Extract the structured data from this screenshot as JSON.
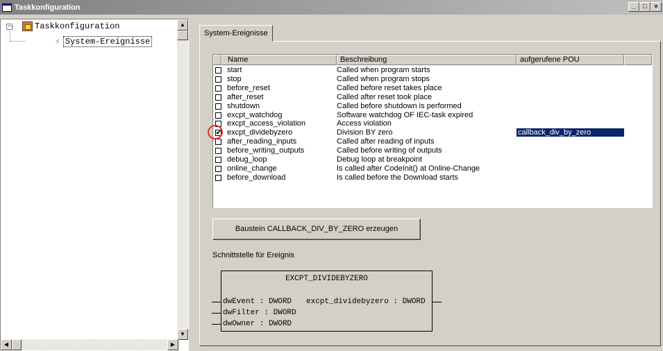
{
  "window": {
    "title": "Taskkonfiguration",
    "buttons": [
      "_",
      "□",
      "×"
    ]
  },
  "tree": {
    "root": {
      "label": "Taskkonfiguration",
      "expander": "−",
      "icon": "task-config-icon"
    },
    "child": {
      "label": "System-Ereignisse",
      "icon": "lightning-icon"
    }
  },
  "tab": {
    "label": "System-Ereignisse"
  },
  "list": {
    "columns": [
      "Name",
      "Beschreibung",
      "aufgerufene POU"
    ],
    "rows": [
      {
        "checked": false,
        "name": "start",
        "desc": "Called when program starts",
        "pou": ""
      },
      {
        "checked": false,
        "name": "stop",
        "desc": "Called when program stops",
        "pou": ""
      },
      {
        "checked": false,
        "name": "before_reset",
        "desc": "Called before reset takes place",
        "pou": ""
      },
      {
        "checked": false,
        "name": "after_reset",
        "desc": "Called after reset took place",
        "pou": ""
      },
      {
        "checked": false,
        "name": "shutdown",
        "desc": "Called before shutdown is performed",
        "pou": ""
      },
      {
        "checked": false,
        "name": "excpt_watchdog",
        "desc": "Software watchdog OF IEC-task expired",
        "pou": ""
      },
      {
        "checked": false,
        "name": "excpt_access_violation",
        "desc": "Access violation",
        "pou": ""
      },
      {
        "checked": true,
        "name": "excpt_dividebyzero",
        "desc": "Division BY zero",
        "pou": "callback_div_by_zero"
      },
      {
        "checked": false,
        "name": "after_reading_inputs",
        "desc": "Called after reading of inputs",
        "pou": ""
      },
      {
        "checked": false,
        "name": "before_writing_outputs",
        "desc": "Called before writing of outputs",
        "pou": ""
      },
      {
        "checked": false,
        "name": "debug_loop",
        "desc": "Debug loop at breakpoint",
        "pou": ""
      },
      {
        "checked": false,
        "name": "online_change",
        "desc": "Is called after CodeInit() at Online-Change",
        "pou": ""
      },
      {
        "checked": false,
        "name": "before_download",
        "desc": "Is called before the Download starts",
        "pou": ""
      }
    ],
    "check_mark": "✔"
  },
  "generate_button": {
    "label": "Baustein CALLBACK_DIV_BY_ZERO erzeugen"
  },
  "interface": {
    "label": "Schnittstelle für Ereignis",
    "block_title": "EXCPT_DIVIDEBYZERO",
    "inputs": [
      "dwEvent : DWORD",
      "dwFilter : DWORD",
      "dwOwner : DWORD"
    ],
    "output": "excpt_dividebyzero : DWORD"
  },
  "colors": {
    "selection": "#0a246a",
    "highlight_circle": "#e03020",
    "face": "#d4d0c8"
  }
}
